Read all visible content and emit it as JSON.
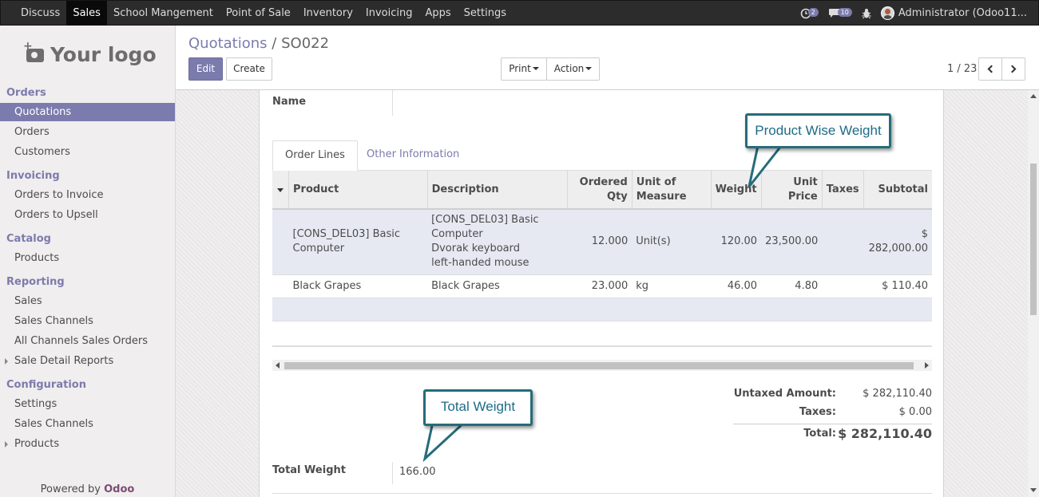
{
  "navbar": {
    "menu": [
      "Discuss",
      "Sales",
      "School Mangement",
      "Point of Sale",
      "Inventory",
      "Invoicing",
      "Apps",
      "Settings"
    ],
    "active": "Sales",
    "activity_count": "2",
    "messages_count": "10",
    "user_name": "Administrator (Odoo11..."
  },
  "sidebar": {
    "logo_text": "Your logo",
    "sections": {
      "orders": "Orders",
      "invoicing": "Invoicing",
      "catalog": "Catalog",
      "reporting": "Reporting",
      "configuration": "Configuration"
    },
    "items": {
      "quotations": "Quotations",
      "orders": "Orders",
      "customers": "Customers",
      "orders_to_invoice": "Orders to Invoice",
      "orders_to_upsell": "Orders to Upsell",
      "products": "Products",
      "sales": "Sales",
      "sales_channels": "Sales Channels",
      "all_channels": "All Channels Sales Orders",
      "sale_detail_reports": "Sale Detail Reports",
      "settings": "Settings",
      "config_sales_channels": "Sales Channels",
      "config_products": "Products"
    },
    "powered_prefix": "Powered by",
    "powered_brand": "Odoo"
  },
  "control": {
    "breadcrumb_parent": "Quotations",
    "breadcrumb_sep": "/",
    "breadcrumb_current": "SO022",
    "edit_label": "Edit",
    "create_label": "Create",
    "print_label": "Print",
    "action_label": "Action",
    "pager": "1 / 23"
  },
  "form": {
    "name_label": "Name",
    "tabs": [
      "Order Lines",
      "Other Information"
    ],
    "columns": [
      "Product",
      "Description",
      "Ordered Qty",
      "Unit of Measure",
      "Weight",
      "Unit Price",
      "Taxes",
      "Subtotal"
    ],
    "lines": [
      {
        "product": "[CONS_DEL03] Basic Computer",
        "description": [
          "[CONS_DEL03] Basic",
          "Computer",
          "Dvorak keyboard",
          "left-handed mouse"
        ],
        "qty": "12.000",
        "uom": "Unit(s)",
        "weight": "120.00",
        "price": "23,500.00",
        "taxes": "",
        "subtotal": "$ 282,000.00"
      },
      {
        "product": "Black Grapes",
        "description": [
          "Black Grapes"
        ],
        "qty": "23.000",
        "uom": "kg",
        "weight": "46.00",
        "price": "4.80",
        "taxes": "",
        "subtotal": "$ 110.40"
      }
    ],
    "totals": {
      "untaxed_label": "Untaxed Amount:",
      "untaxed_value": "$ 282,110.40",
      "taxes_label": "Taxes:",
      "taxes_value": "$ 0.00",
      "total_label": "Total:",
      "total_value": "$ 282,110.40"
    },
    "total_weight_label": "Total Weight",
    "total_weight_value": "166.00"
  },
  "callouts": {
    "product_weight": "Product Wise Weight",
    "total_weight": "Total Weight"
  },
  "colors": {
    "brand": "#7c7bad",
    "navbar": "#2c2c2c",
    "callout_border": "#266c7a",
    "callout_text": "#1d6c87"
  }
}
